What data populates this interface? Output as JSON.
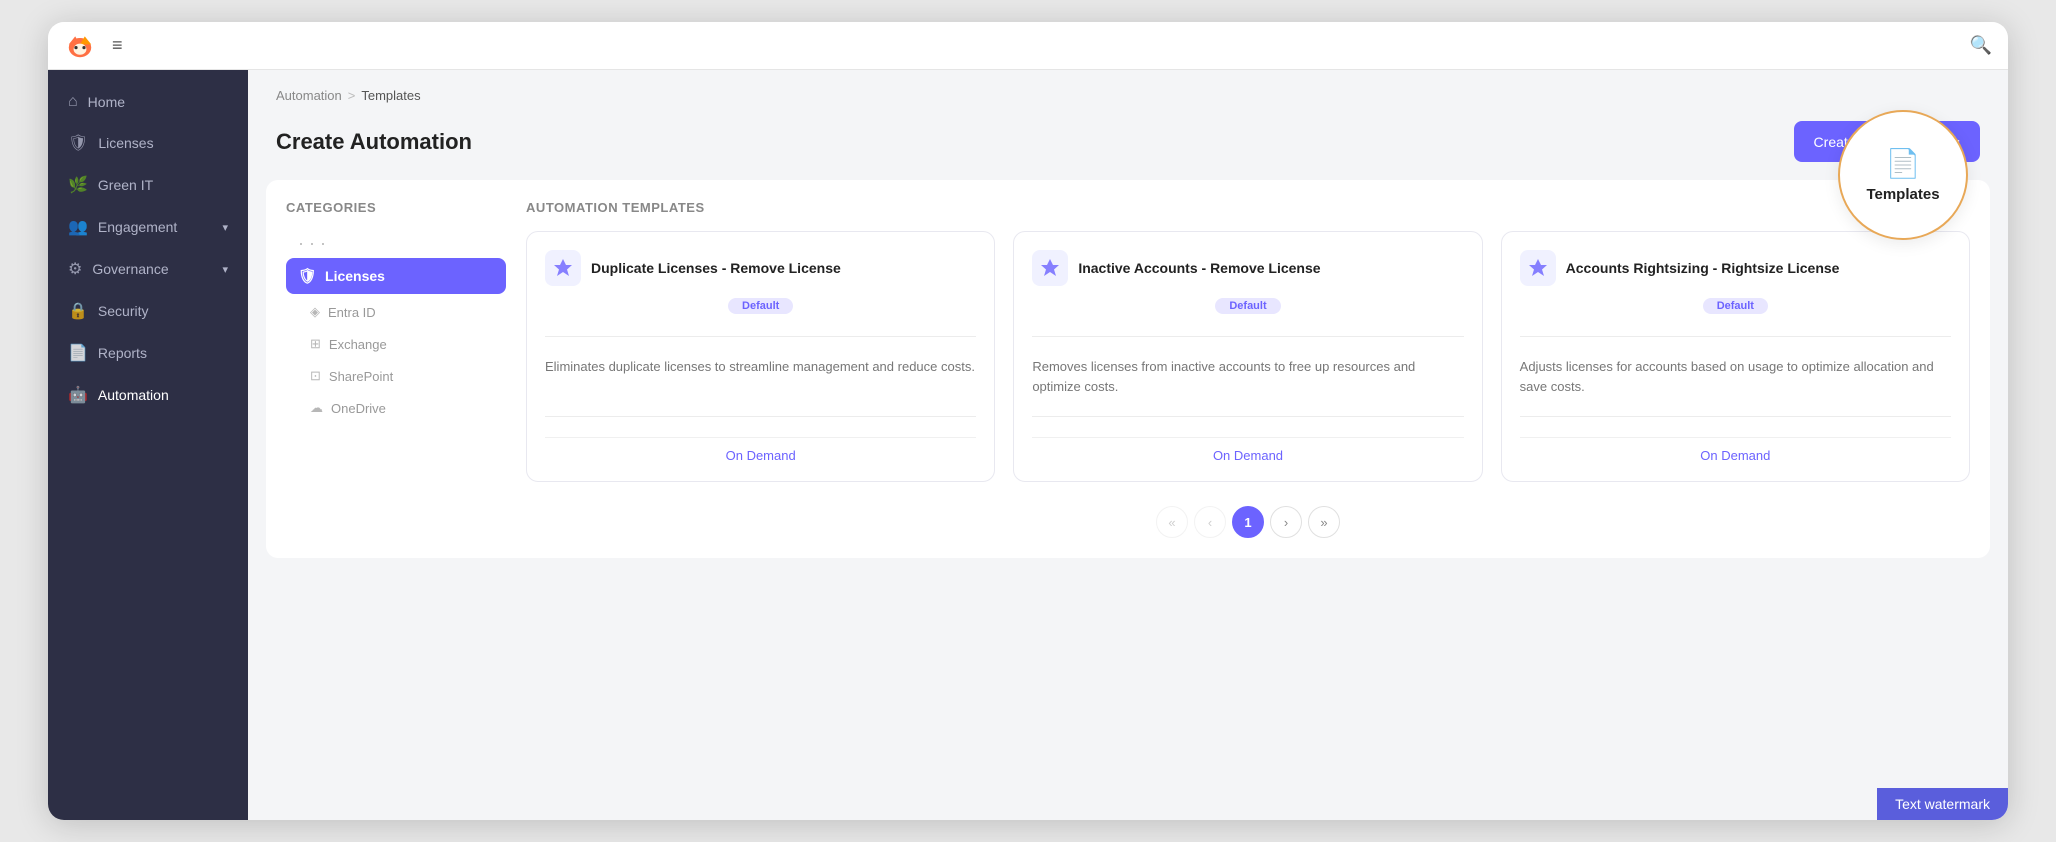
{
  "window": {
    "title": "Automation Templates"
  },
  "topbar": {
    "hamburger": "≡",
    "search_icon": "🔍"
  },
  "sidebar": {
    "items": [
      {
        "id": "home",
        "label": "Home",
        "icon": "⌂",
        "active": false
      },
      {
        "id": "licenses",
        "label": "Licenses",
        "icon": "🛡",
        "active": false
      },
      {
        "id": "green-it",
        "label": "Green IT",
        "icon": "🌿",
        "active": false
      },
      {
        "id": "engagement",
        "label": "Engagement",
        "icon": "👥",
        "active": false,
        "has_chevron": true
      },
      {
        "id": "governance",
        "label": "Governance",
        "icon": "⚙",
        "active": false,
        "has_chevron": true
      },
      {
        "id": "security",
        "label": "Security",
        "icon": "🔒",
        "active": false
      },
      {
        "id": "reports",
        "label": "Reports",
        "icon": "📄",
        "active": false
      },
      {
        "id": "automation",
        "label": "Automation",
        "icon": "🤖",
        "active": true
      }
    ]
  },
  "breadcrumb": {
    "parent": "Automation",
    "separator": ">",
    "current": "Templates"
  },
  "page": {
    "title": "Create Automation",
    "create_btn_label": "Create From Scratch",
    "create_btn_plus": "+"
  },
  "categories": {
    "title": "Categories",
    "items": [
      {
        "id": "licenses",
        "label": "Licenses",
        "icon": "🛡",
        "active": true
      },
      {
        "id": "entra-id",
        "label": "Entra ID",
        "icon": "◈",
        "sub": true
      },
      {
        "id": "exchange",
        "label": "Exchange",
        "icon": "⊞",
        "sub": true
      },
      {
        "id": "sharepoint",
        "label": "SharePoint",
        "icon": "⊡",
        "sub": true
      },
      {
        "id": "onedrive",
        "label": "OneDrive",
        "icon": "☁",
        "sub": true
      }
    ],
    "dots": "· · ·"
  },
  "templates": {
    "title": "Automation Templates",
    "cards": [
      {
        "id": "duplicate-licenses",
        "icon": "⚡",
        "name": "Duplicate Licenses - Remove License",
        "badge": "Default",
        "description": "Eliminates duplicate licenses to streamline management and reduce costs.",
        "schedule": "On Demand"
      },
      {
        "id": "inactive-accounts",
        "icon": "⚡",
        "name": "Inactive Accounts - Remove License",
        "badge": "Default",
        "description": "Removes licenses from inactive accounts to free up resources and optimize costs.",
        "schedule": "On Demand"
      },
      {
        "id": "accounts-rightsizing",
        "icon": "⚡",
        "name": "Accounts Rightsizing - Rightsize License",
        "badge": "Default",
        "description": "Adjusts licenses for accounts based on usage to optimize allocation and save costs.",
        "schedule": "On Demand"
      }
    ]
  },
  "pagination": {
    "first": "«",
    "prev": "‹",
    "current": "1",
    "next": "›",
    "last": "»"
  },
  "circle_overlay": {
    "icon": "📄",
    "label": "Templates"
  },
  "watermark": {
    "text": "Text watermark"
  }
}
